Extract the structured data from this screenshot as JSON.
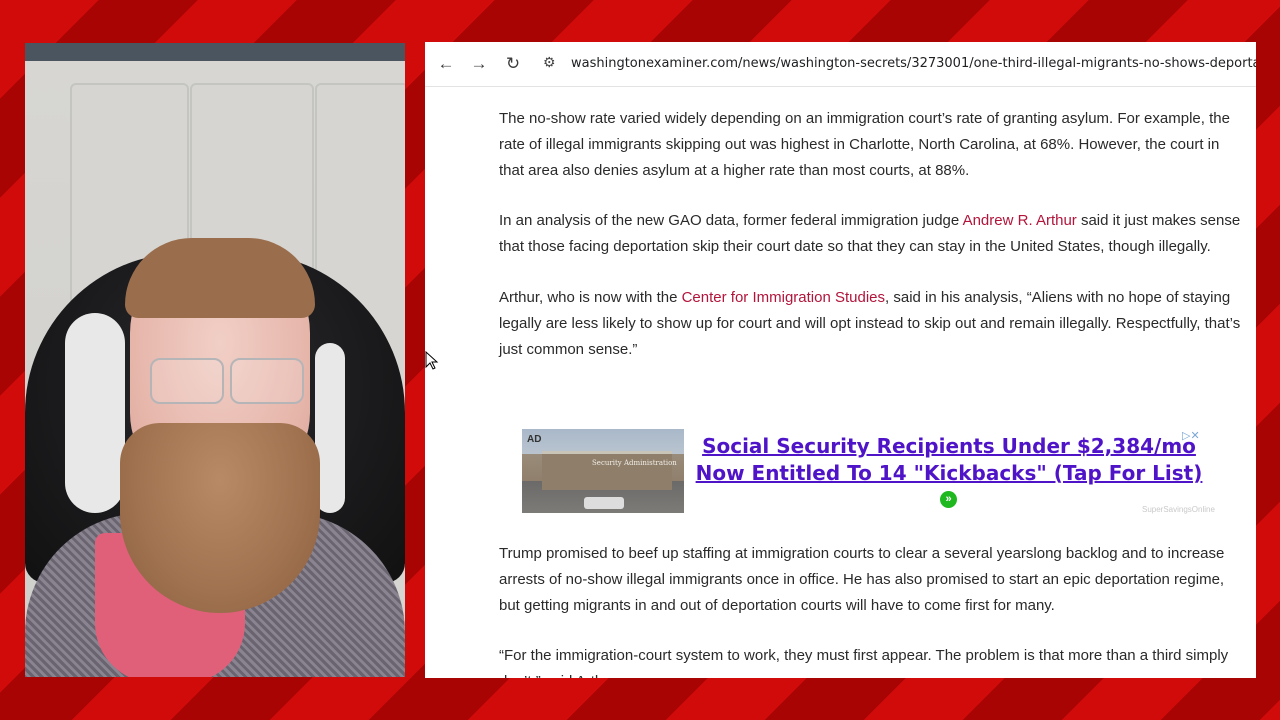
{
  "browser": {
    "url": "washingtonexaminer.com/news/washington-secrets/3273001/one-third-illegal-migrants-no-shows-deportation-hearin"
  },
  "article": {
    "p1": "The no-show rate varied widely depending on an immigration court’s rate of granting asylum. For example, the rate of illegal immigrants skipping out was highest in Charlotte, North Carolina, at 68%. However, the court in that area also denies asylum at a higher rate than most courts, at 88%.",
    "p2_before": "In an analysis of the new GAO data, former federal immigration judge ",
    "p2_link": "Andrew R. Arthur",
    "p2_after": " said it just makes sense that those facing deportation skip their court date so that they can stay in the United States, though illegally.",
    "p3_before": "Arthur, who is now with the ",
    "p3_link": "Center for Immigration Studies",
    "p3_after": ", said in his analysis, “Aliens with no hope of staying legally are less likely to show up for court and will opt instead to skip out and remain illegally. Respectfully, that’s just common sense.”",
    "p4": "Trump promised to beef up staffing at immigration courts to clear a several yearslong backlog and to increase arrests of no-show illegal immigrants once in office. He has also promised to start an epic deportation regime, but getting migrants in and out of deportation courts will have to come first for many.",
    "p5": "“For the immigration-court system to work, they must first appear. The problem is that more than a third simply don’t,” said Arthur."
  },
  "ad": {
    "label": "AD",
    "sign_text": "Security Administration",
    "headline": "Social Security Recipients Under $2,384/mo Now Entitled To 14 \"Kickbacks\" (Tap For List)",
    "source": "SuperSavingsOnline",
    "close_icon": "close-icon",
    "arrow_icon": "arrow-right-icon"
  },
  "colors": {
    "link": "#b3143a",
    "ad_headline": "#4f14c8",
    "frame_red": "#d10a0a"
  }
}
